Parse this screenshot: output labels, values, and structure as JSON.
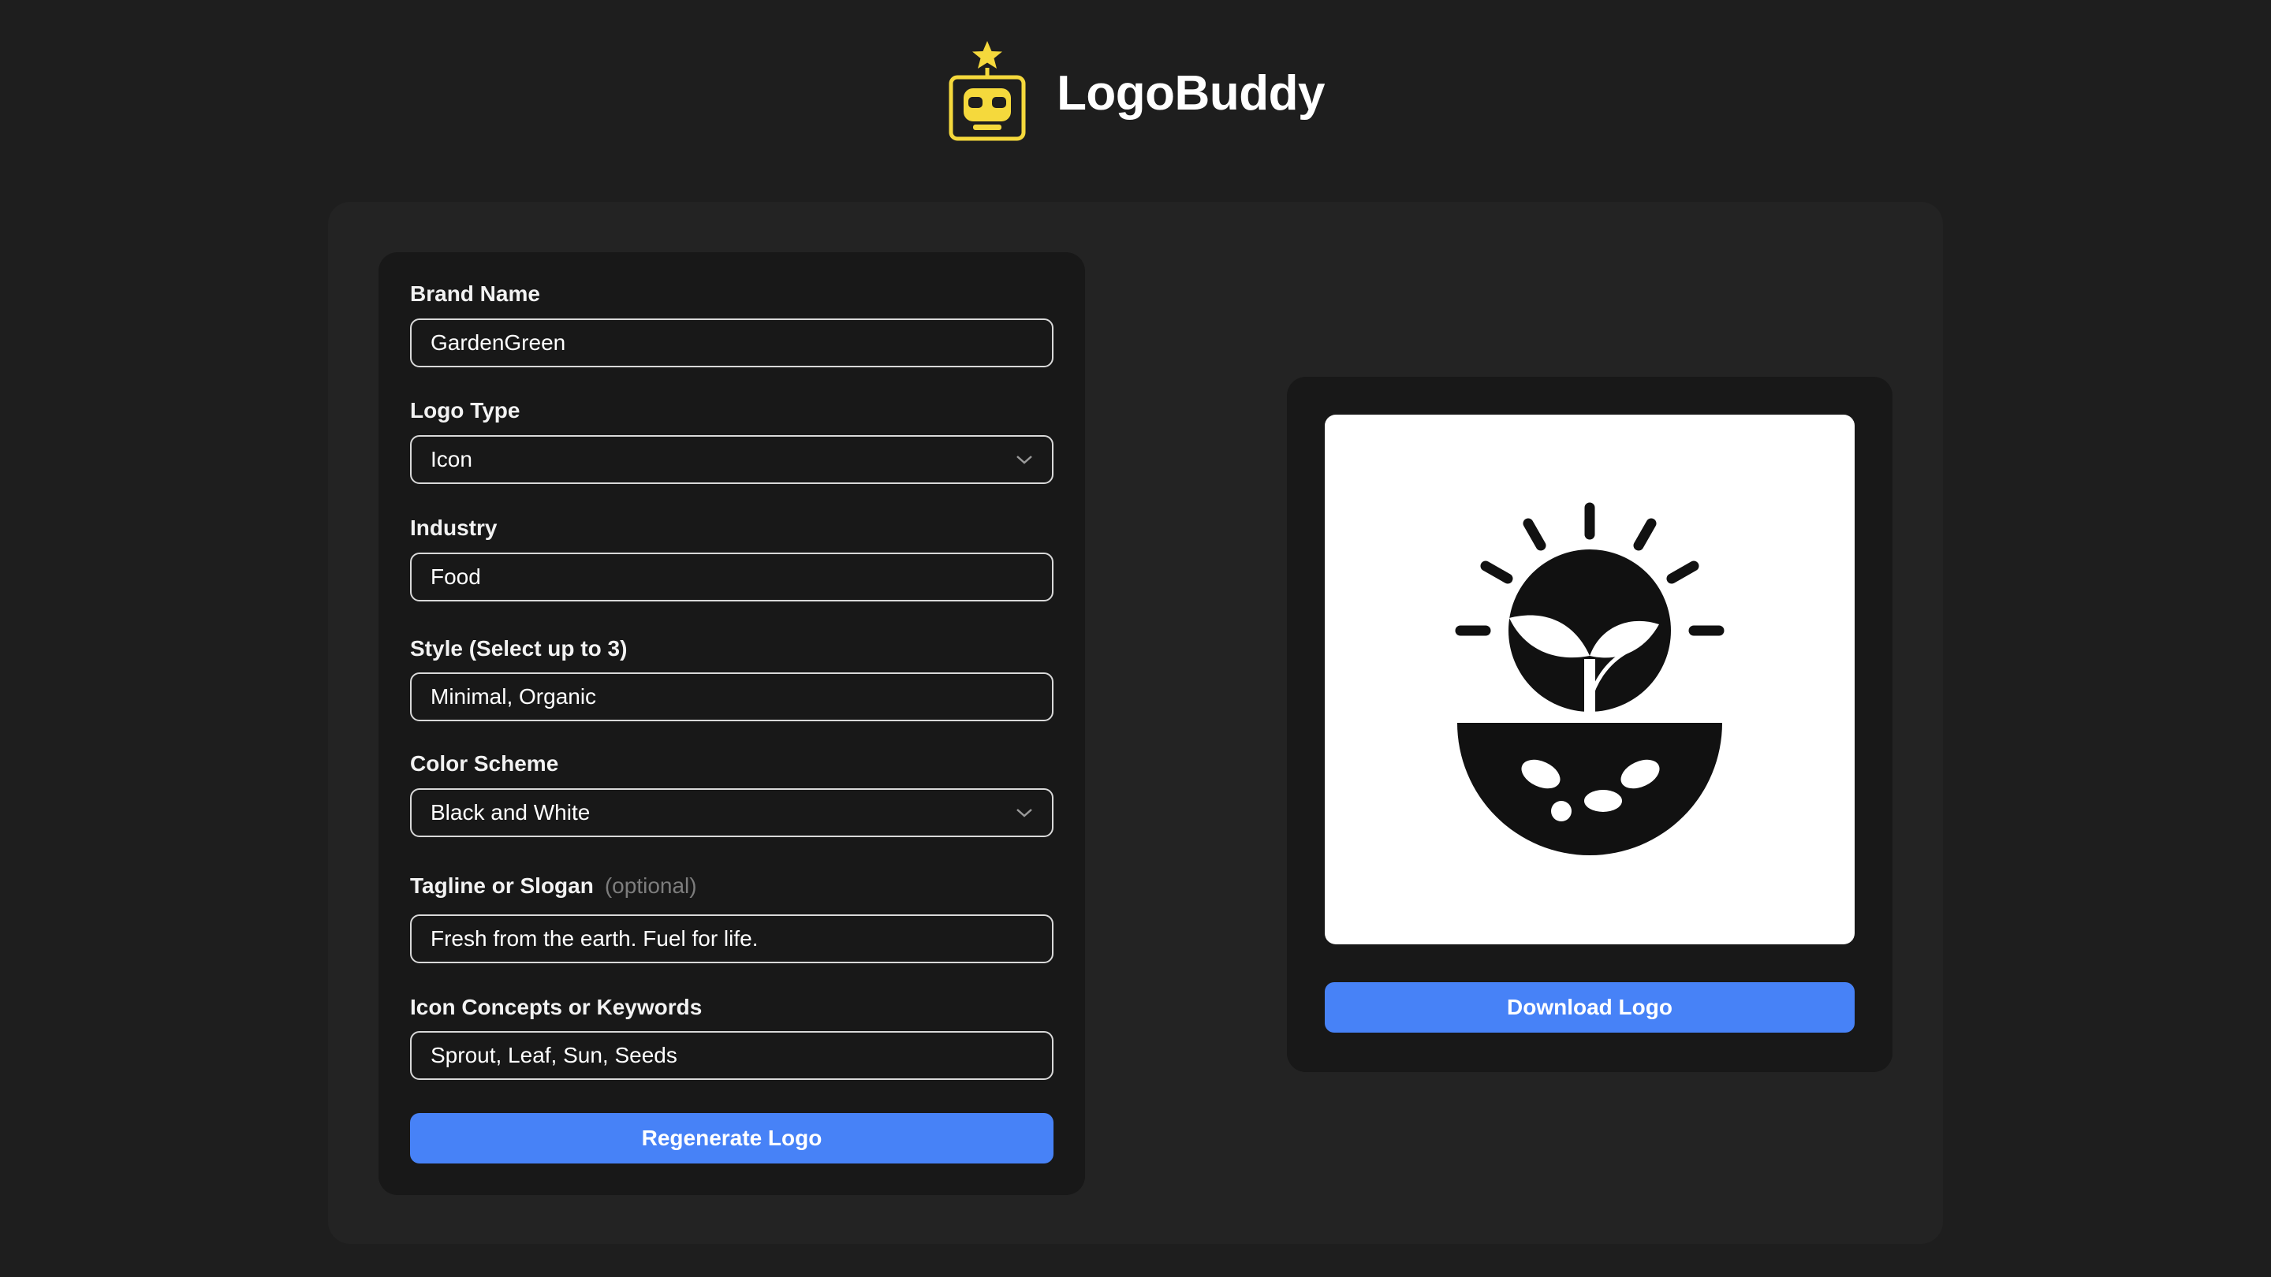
{
  "app": {
    "title": "LogoBuddy",
    "logo_icon": "robot-star-icon",
    "accent_color": "#F5D93C"
  },
  "form": {
    "fields": [
      {
        "label": "Brand Name",
        "value": "GardenGreen",
        "type": "text"
      },
      {
        "label": "Logo Type",
        "value": "Icon",
        "type": "select"
      },
      {
        "label": "Industry",
        "value": "Food",
        "type": "text"
      },
      {
        "label": "Style (Select up to 3)",
        "value": "Minimal, Organic",
        "type": "text"
      },
      {
        "label": "Color Scheme",
        "value": "Black and White",
        "type": "select"
      },
      {
        "label": "Tagline or Slogan",
        "hint": "(optional)",
        "value": "Fresh from the earth. Fuel for life.",
        "type": "text"
      },
      {
        "label": "Icon Concepts or Keywords",
        "value": "Sprout, Leaf, Sun, Seeds",
        "type": "text"
      }
    ],
    "regenerate_label": "Regenerate Logo"
  },
  "preview": {
    "image_icon": "sprout-sun-logo-icon",
    "download_label": "Download Logo"
  },
  "colors": {
    "background": "#1E1E1E",
    "panel": "#232323",
    "card": "#181818",
    "button": "#4782F7",
    "input_border": "#D9D9D9"
  }
}
